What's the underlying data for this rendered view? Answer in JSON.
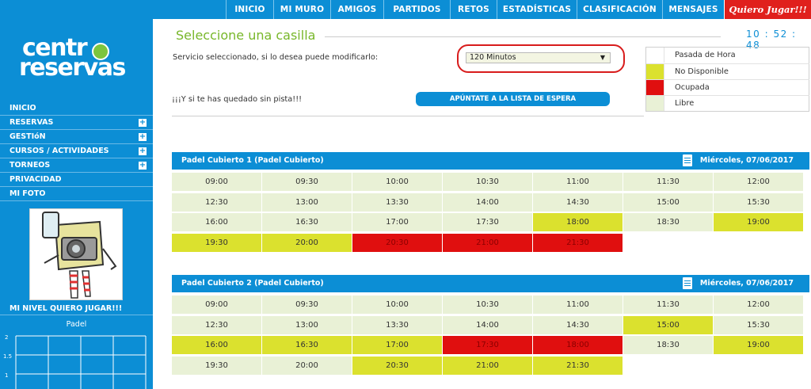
{
  "nav": {
    "items": [
      "INICIO",
      "MI MURO",
      "AMIGOS",
      "PARTIDOS",
      "RETOS",
      "ESTADÍSTICAS",
      "CLASIFICACIÓN",
      "MENSAJES"
    ],
    "quiero": "Quiero Jugar!!!"
  },
  "logo": {
    "line1": "centr",
    "line2": "reservas"
  },
  "sidebar": {
    "menu": [
      {
        "label": "INICIO",
        "expandable": false
      },
      {
        "label": "RESERVAS",
        "expandable": true
      },
      {
        "label": "GESTIóN",
        "expandable": true
      },
      {
        "label": "CURSOS / ACTIVIDADES",
        "expandable": true
      },
      {
        "label": "TORNEOS",
        "expandable": true
      },
      {
        "label": "PRIVACIDAD",
        "expandable": false
      },
      {
        "label": "MI FOTO",
        "expandable": false
      }
    ],
    "nivel_title": "MI NIVEL QUIERO JUGAR!!!",
    "chart_sport": "Padel",
    "chart_ticks": [
      "2",
      "1.5",
      "1"
    ]
  },
  "page": {
    "title": "Seleccione una casilla",
    "clock": "10 : 52 : 48",
    "service_label": "Servicio seleccionado, si lo desea puede modificarlo:",
    "service_value": "120 Minutos",
    "sin_pista": "¡¡¡Y si te has quedado sin pista!!!",
    "wait_button": "APÚNTATE A LA LISTA DE ESPERA"
  },
  "legend": [
    {
      "label": "Pasada de Hora",
      "color": "#ffffff"
    },
    {
      "label": "No Disponible",
      "color": "#dbe12e"
    },
    {
      "label": "Ocupada",
      "color": "#e00f0f"
    },
    {
      "label": "Libre",
      "color": "#e9f1d6"
    }
  ],
  "courts": [
    {
      "name": "Padel Cubierto 1 (Padel Cubierto)",
      "date": "Miércoles, 07/06/2017",
      "slots": [
        {
          "time": "09:00",
          "state": "libre"
        },
        {
          "time": "09:30",
          "state": "libre"
        },
        {
          "time": "10:00",
          "state": "libre"
        },
        {
          "time": "10:30",
          "state": "libre"
        },
        {
          "time": "11:00",
          "state": "libre"
        },
        {
          "time": "11:30",
          "state": "libre"
        },
        {
          "time": "12:00",
          "state": "libre"
        },
        {
          "time": "12:30",
          "state": "libre"
        },
        {
          "time": "13:00",
          "state": "libre"
        },
        {
          "time": "13:30",
          "state": "libre"
        },
        {
          "time": "14:00",
          "state": "libre"
        },
        {
          "time": "14:30",
          "state": "libre"
        },
        {
          "time": "15:00",
          "state": "libre"
        },
        {
          "time": "15:30",
          "state": "libre"
        },
        {
          "time": "16:00",
          "state": "libre"
        },
        {
          "time": "16:30",
          "state": "libre"
        },
        {
          "time": "17:00",
          "state": "libre"
        },
        {
          "time": "17:30",
          "state": "libre"
        },
        {
          "time": "18:00",
          "state": "nd"
        },
        {
          "time": "18:30",
          "state": "libre"
        },
        {
          "time": "19:00",
          "state": "nd"
        },
        {
          "time": "19:30",
          "state": "nd"
        },
        {
          "time": "20:00",
          "state": "nd"
        },
        {
          "time": "20:30",
          "state": "ocup"
        },
        {
          "time": "21:00",
          "state": "ocup"
        },
        {
          "time": "21:30",
          "state": "ocup"
        }
      ]
    },
    {
      "name": "Padel Cubierto 2 (Padel Cubierto)",
      "date": "Miércoles, 07/06/2017",
      "slots": [
        {
          "time": "09:00",
          "state": "libre"
        },
        {
          "time": "09:30",
          "state": "libre"
        },
        {
          "time": "10:00",
          "state": "libre"
        },
        {
          "time": "10:30",
          "state": "libre"
        },
        {
          "time": "11:00",
          "state": "libre"
        },
        {
          "time": "11:30",
          "state": "libre"
        },
        {
          "time": "12:00",
          "state": "libre"
        },
        {
          "time": "12:30",
          "state": "libre"
        },
        {
          "time": "13:00",
          "state": "libre"
        },
        {
          "time": "13:30",
          "state": "libre"
        },
        {
          "time": "14:00",
          "state": "libre"
        },
        {
          "time": "14:30",
          "state": "libre"
        },
        {
          "time": "15:00",
          "state": "nd"
        },
        {
          "time": "15:30",
          "state": "libre"
        },
        {
          "time": "16:00",
          "state": "nd"
        },
        {
          "time": "16:30",
          "state": "nd"
        },
        {
          "time": "17:00",
          "state": "nd"
        },
        {
          "time": "17:30",
          "state": "ocup"
        },
        {
          "time": "18:00",
          "state": "ocup"
        },
        {
          "time": "18:30",
          "state": "libre"
        },
        {
          "time": "19:00",
          "state": "nd"
        },
        {
          "time": "19:30",
          "state": "libre"
        },
        {
          "time": "20:00",
          "state": "libre"
        },
        {
          "time": "20:30",
          "state": "nd"
        },
        {
          "time": "21:00",
          "state": "nd"
        },
        {
          "time": "21:30",
          "state": "nd"
        }
      ]
    }
  ]
}
